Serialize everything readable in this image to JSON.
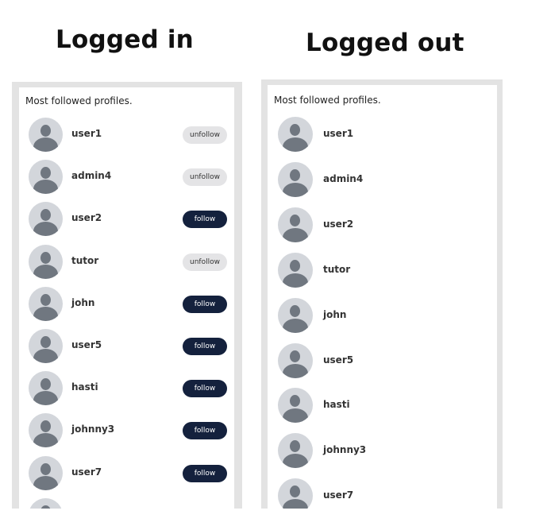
{
  "titles": {
    "logged_in": "Logged in",
    "logged_out": "Logged out"
  },
  "panels": {
    "logged_in": {
      "heading": "Most followed profiles.",
      "profiles": [
        {
          "username": "user1",
          "action": "unfollow"
        },
        {
          "username": "admin4",
          "action": "unfollow"
        },
        {
          "username": "user2",
          "action": "follow"
        },
        {
          "username": "tutor",
          "action": "unfollow"
        },
        {
          "username": "john",
          "action": "follow"
        },
        {
          "username": "user5",
          "action": "follow"
        },
        {
          "username": "hasti",
          "action": "follow"
        },
        {
          "username": "johnny3",
          "action": "follow"
        },
        {
          "username": "user7",
          "action": "follow"
        }
      ]
    },
    "logged_out": {
      "heading": "Most followed profiles.",
      "profiles": [
        {
          "username": "user1"
        },
        {
          "username": "admin4"
        },
        {
          "username": "user2"
        },
        {
          "username": "tutor"
        },
        {
          "username": "john"
        },
        {
          "username": "user5"
        },
        {
          "username": "hasti"
        },
        {
          "username": "johnny3"
        },
        {
          "username": "user7"
        }
      ]
    }
  },
  "icons": {
    "avatar": "default-user-avatar-icon"
  },
  "colors": {
    "follow_button_bg": "#14213d",
    "follow_button_text": "#ffffff",
    "unfollow_button_bg": "#e4e4e6",
    "unfollow_button_text": "#333333",
    "avatar_bg": "#d3d6db",
    "avatar_figure": "#707780",
    "panel_frame": "#e3e3e3"
  }
}
